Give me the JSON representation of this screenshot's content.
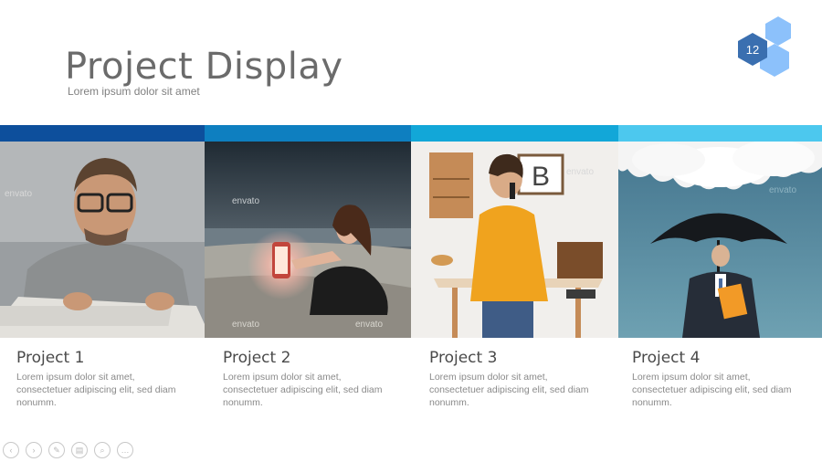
{
  "header": {
    "title": "Project Display",
    "subtitle": "Lorem ipsum dolor sit amet",
    "page_number": "12"
  },
  "projects": [
    {
      "title": "Project 1",
      "desc_line1": "Lorem ipsum dolor sit amet,",
      "desc_line2": "consectetuer adipiscing elit, sed diam",
      "desc_line3": "nonumm.",
      "band_color": "#0d4f9c"
    },
    {
      "title": "Project 2",
      "desc_line1": "Lorem ipsum dolor sit amet,",
      "desc_line2": "consectetuer adipiscing elit, sed diam",
      "desc_line3": "nonumm.",
      "band_color": "#0e7fc0"
    },
    {
      "title": "Project 3",
      "desc_line1": "Lorem ipsum dolor sit amet,",
      "desc_line2": "consectetuer adipiscing elit, sed diam",
      "desc_line3": "nonumm.",
      "band_color": "#12a7d8"
    },
    {
      "title": "Project 4",
      "desc_line1": "Lorem ipsum dolor sit amet,",
      "desc_line2": "consectetuer adipiscing elit, sed diam",
      "desc_line3": "nonumm.",
      "band_color": "#4cc8ee"
    }
  ],
  "photo_watermark": "envato",
  "photo_sign_letter": "B",
  "controls": [
    {
      "name": "previous-slide-icon",
      "glyph": "‹"
    },
    {
      "name": "next-slide-icon",
      "glyph": "›"
    },
    {
      "name": "pen-icon",
      "glyph": "✎"
    },
    {
      "name": "slides-icon",
      "glyph": "▤"
    },
    {
      "name": "zoom-icon",
      "glyph": "⌕"
    },
    {
      "name": "more-options-icon",
      "glyph": "…"
    }
  ],
  "colors": {
    "hex_dark": "#3a6fb0",
    "hex_mid": "#5ea3f0",
    "hex_light": "#8cc1fb"
  }
}
